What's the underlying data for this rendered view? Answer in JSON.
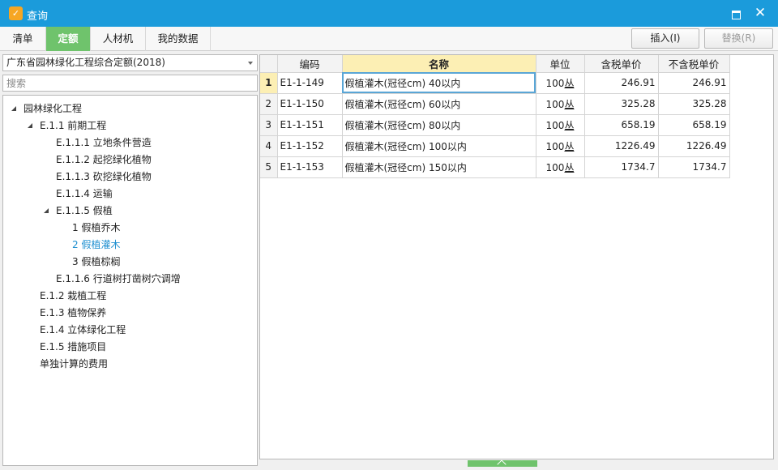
{
  "window": {
    "title": "查询",
    "icon": "app-logo-icon",
    "maximize_icon": "maximize-icon",
    "close_icon": "close-icon",
    "close_glyph": "✕"
  },
  "tabs": [
    {
      "label": "清单",
      "active": false
    },
    {
      "label": "定额",
      "active": true
    },
    {
      "label": "人材机",
      "active": false
    },
    {
      "label": "我的数据",
      "active": false
    }
  ],
  "buttons": {
    "insert_label": "插入(I)",
    "replace_label": "替换(R)",
    "replace_enabled": false
  },
  "left": {
    "quota_library": "广东省园林绿化工程综合定额(2018)",
    "search_placeholder": "搜索",
    "search_value": "",
    "tree": [
      {
        "label": "园林绿化工程",
        "state": "open"
      },
      {
        "label": "E.1.1 前期工程",
        "state": "open"
      },
      {
        "label": "E.1.1.1 立地条件营造",
        "state": "closed"
      },
      {
        "label": "E.1.1.2 起挖绿化植物",
        "state": "closed"
      },
      {
        "label": "E.1.1.3 砍挖绿化植物",
        "state": "closed"
      },
      {
        "label": "E.1.1.4 运输",
        "state": "closed"
      },
      {
        "label": "E.1.1.5 假植",
        "state": "open"
      },
      {
        "label": "1 假植乔木",
        "state": "leaf"
      },
      {
        "label": "2 假植灌木",
        "state": "leaf",
        "selected": true
      },
      {
        "label": "3 假植棕榈",
        "state": "leaf"
      },
      {
        "label": "E.1.1.6 行道树打凿树穴调增",
        "state": "closed"
      },
      {
        "label": "E.1.2 栽植工程",
        "state": "closed"
      },
      {
        "label": "E.1.3 植物保养",
        "state": "closed"
      },
      {
        "label": "E.1.4 立体绿化工程",
        "state": "closed"
      },
      {
        "label": "E.1.5 措施项目",
        "state": "closed"
      },
      {
        "label": "单独计算的费用",
        "state": "leaf"
      }
    ]
  },
  "grid": {
    "columns": [
      "",
      "编码",
      "名称",
      "单位",
      "含税单价",
      "不含税单价"
    ],
    "sorted_column": "名称",
    "rows": [
      {
        "no": "1",
        "code": "E1-1-149",
        "name": "假植灌木(冠径cm) 40以内",
        "unit_num": "100",
        "unit_word": "丛",
        "tax_price": "246.91",
        "notax_price": "246.91"
      },
      {
        "no": "2",
        "code": "E1-1-150",
        "name": "假植灌木(冠径cm) 60以内",
        "unit_num": "100",
        "unit_word": "丛",
        "tax_price": "325.28",
        "notax_price": "325.28"
      },
      {
        "no": "3",
        "code": "E1-1-151",
        "name": "假植灌木(冠径cm) 80以内",
        "unit_num": "100",
        "unit_word": "丛",
        "tax_price": "658.19",
        "notax_price": "658.19"
      },
      {
        "no": "4",
        "code": "E1-1-152",
        "name": "假植灌木(冠径cm) 100以内",
        "unit_num": "100",
        "unit_word": "丛",
        "tax_price": "1226.49",
        "notax_price": "1226.49"
      },
      {
        "no": "5",
        "code": "E1-1-153",
        "name": "假植灌木(冠径cm) 150以内",
        "unit_num": "100",
        "unit_word": "丛",
        "tax_price": "1734.7",
        "notax_price": "1734.7"
      }
    ]
  },
  "colors": {
    "titlebar": "#1b9bdb",
    "active_tab": "#6fc36c",
    "selection": "#fcefb4",
    "tree_selected_text": "#1e8fd0"
  }
}
